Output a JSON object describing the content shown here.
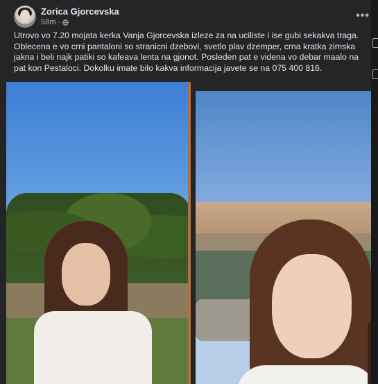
{
  "post": {
    "author": "Zorica Gjorcevska",
    "time": "58m",
    "dot": "·",
    "more": "•••",
    "text": "Utrovo vo 7.20 mojata kerka Vanja Gjorcevska izleze za na uciliste i ise gubi sekakva traga. Oblecena e vo crni pantaloni so stranicni dzebovi, svetlo plav dzemper, crna kratka zimska jakna i beli najk patiki so kafeava lenta na gjonot. Posleden pat e videna vo debar maalo na pat kon Pestaloci. Dokolku imate bilo kakva informacija javete se na 075 400 816."
  },
  "icons": {
    "audience": "globe-icon",
    "menu": "more-options-icon"
  },
  "colors": {
    "background": "#242526",
    "text": "#e4e6eb",
    "secondary": "#b0b3b8"
  }
}
